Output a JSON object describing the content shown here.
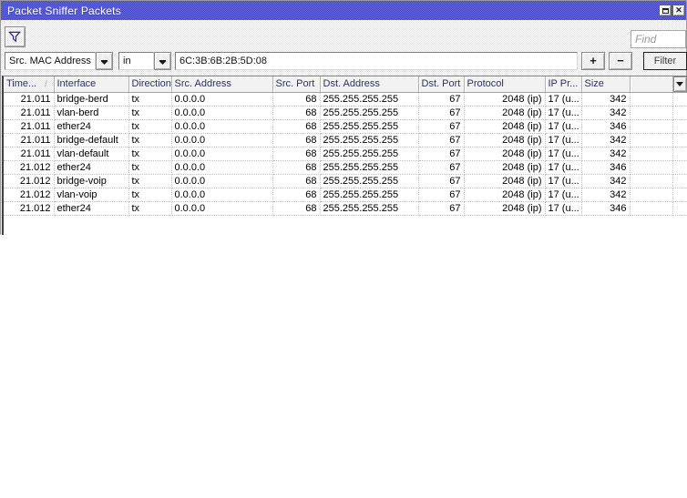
{
  "window": {
    "title": "Packet Sniffer Packets"
  },
  "icons": {
    "close": "✕",
    "sort_ascending": "/"
  },
  "toolbar": {
    "find_placeholder": "Find"
  },
  "filter_bar": {
    "field": "Src. MAC Address",
    "operator": "in",
    "value": "6C:3B:6B:2B:5D:08",
    "add_label": "+",
    "remove_label": "−",
    "filter_label": "Filter"
  },
  "table": {
    "columns": [
      {
        "label": "Time..."
      },
      {
        "label": "Interface"
      },
      {
        "label": "Direction"
      },
      {
        "label": "Src. Address"
      },
      {
        "label": "Src. Port"
      },
      {
        "label": "Dst. Address"
      },
      {
        "label": "Dst. Port"
      },
      {
        "label": "Protocol"
      },
      {
        "label": "IP Pr..."
      },
      {
        "label": "Size"
      },
      {
        "label": ""
      }
    ],
    "rows": [
      [
        "21.011",
        "bridge-berd",
        "tx",
        "0.0.0.0",
        "68",
        "255.255.255.255",
        "67",
        "2048 (ip)",
        "17 (u...",
        "342"
      ],
      [
        "21.011",
        "vlan-berd",
        "tx",
        "0.0.0.0",
        "68",
        "255.255.255.255",
        "67",
        "2048 (ip)",
        "17 (u...",
        "342"
      ],
      [
        "21.011",
        "ether24",
        "tx",
        "0.0.0.0",
        "68",
        "255.255.255.255",
        "67",
        "2048 (ip)",
        "17 (u...",
        "346"
      ],
      [
        "21.011",
        "bridge-default",
        "tx",
        "0.0.0.0",
        "68",
        "255.255.255.255",
        "67",
        "2048 (ip)",
        "17 (u...",
        "342"
      ],
      [
        "21.011",
        "vlan-default",
        "tx",
        "0.0.0.0",
        "68",
        "255.255.255.255",
        "67",
        "2048 (ip)",
        "17 (u...",
        "342"
      ],
      [
        "21.012",
        "ether24",
        "tx",
        "0.0.0.0",
        "68",
        "255.255.255.255",
        "67",
        "2048 (ip)",
        "17 (u...",
        "346"
      ],
      [
        "21.012",
        "bridge-voip",
        "tx",
        "0.0.0.0",
        "68",
        "255.255.255.255",
        "67",
        "2048 (ip)",
        "17 (u...",
        "342"
      ],
      [
        "21.012",
        "vlan-voip",
        "tx",
        "0.0.0.0",
        "68",
        "255.255.255.255",
        "67",
        "2048 (ip)",
        "17 (u...",
        "342"
      ],
      [
        "21.012",
        "ether24",
        "tx",
        "0.0.0.0",
        "68",
        "255.255.255.255",
        "67",
        "2048 (ip)",
        "17 (u...",
        "346"
      ]
    ]
  }
}
